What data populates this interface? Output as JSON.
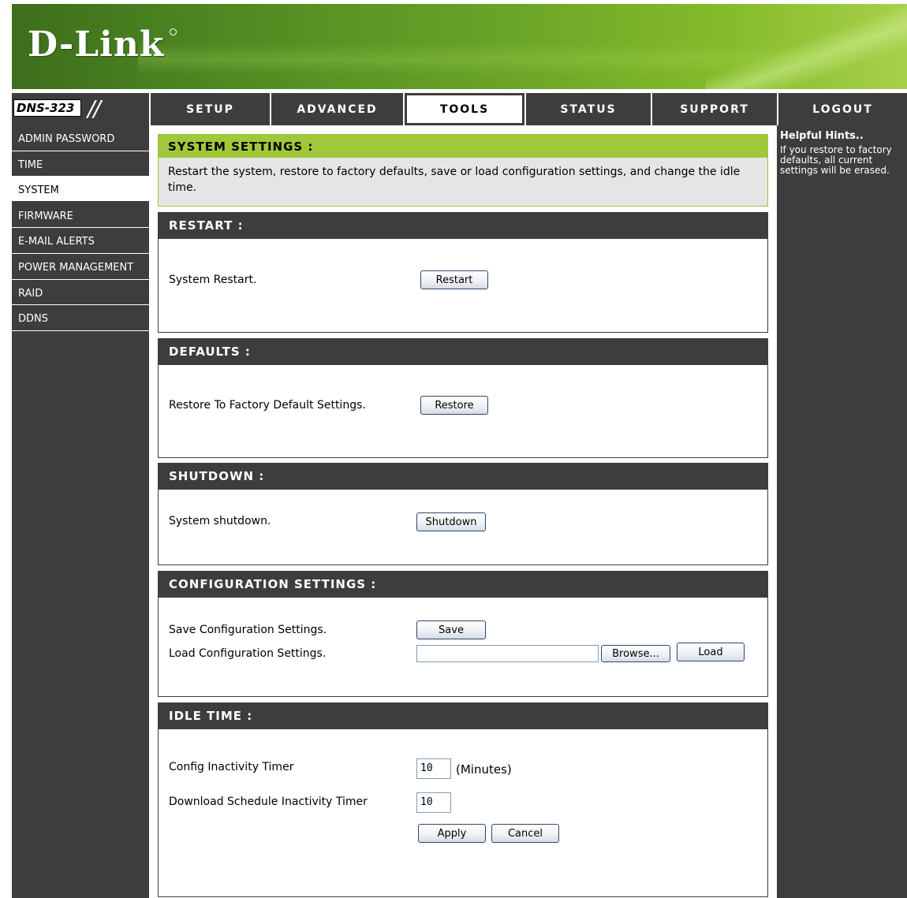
{
  "brand": {
    "logo": "D-Link",
    "model": "DNS-323"
  },
  "nav": {
    "tabs": [
      {
        "label": "SETUP",
        "active": false
      },
      {
        "label": "ADVANCED",
        "active": false
      },
      {
        "label": "TOOLS",
        "active": true
      },
      {
        "label": "STATUS",
        "active": false
      },
      {
        "label": "SUPPORT",
        "active": false
      },
      {
        "label": "LOGOUT",
        "active": false
      }
    ]
  },
  "sidebar": {
    "items": [
      {
        "label": "ADMIN PASSWORD",
        "active": false
      },
      {
        "label": "TIME",
        "active": false
      },
      {
        "label": "SYSTEM",
        "active": true
      },
      {
        "label": "FIRMWARE",
        "active": false
      },
      {
        "label": "E-MAIL ALERTS",
        "active": false
      },
      {
        "label": "POWER MANAGEMENT",
        "active": false
      },
      {
        "label": "RAID",
        "active": false
      },
      {
        "label": "DDNS",
        "active": false
      }
    ]
  },
  "system_settings": {
    "title": "SYSTEM SETTINGS :",
    "description": "Restart the system, restore to factory defaults, save or load configuration settings, and change the idle time."
  },
  "restart": {
    "title": "RESTART :",
    "label": "System Restart.",
    "button": "Restart"
  },
  "defaults": {
    "title": "DEFAULTS :",
    "label": "Restore To Factory Default Settings.",
    "button": "Restore"
  },
  "shutdown": {
    "title": "SHUTDOWN :",
    "label": "System shutdown.",
    "button": "Shutdown"
  },
  "config": {
    "title": "CONFIGURATION SETTINGS :",
    "save_label": "Save Configuration Settings.",
    "save_button": "Save",
    "load_label": "Load Configuration Settings.",
    "file_value": "",
    "browse_button": "Browse...",
    "load_button": "Load"
  },
  "idle": {
    "title": "IDLE TIME :",
    "config_label": "Config Inactivity Timer",
    "config_value": "10",
    "config_unit": "(Minutes)",
    "download_label": "Download Schedule Inactivity Timer",
    "download_value": "10",
    "apply_button": "Apply",
    "cancel_button": "Cancel"
  },
  "hints": {
    "title": "Helpful Hints..",
    "text": "If you restore to factory defaults, all current settings will be erased."
  },
  "colors": {
    "dark": "#3d3d3d",
    "green_header": "#a1c83a",
    "banner_green": "#6aa428"
  }
}
